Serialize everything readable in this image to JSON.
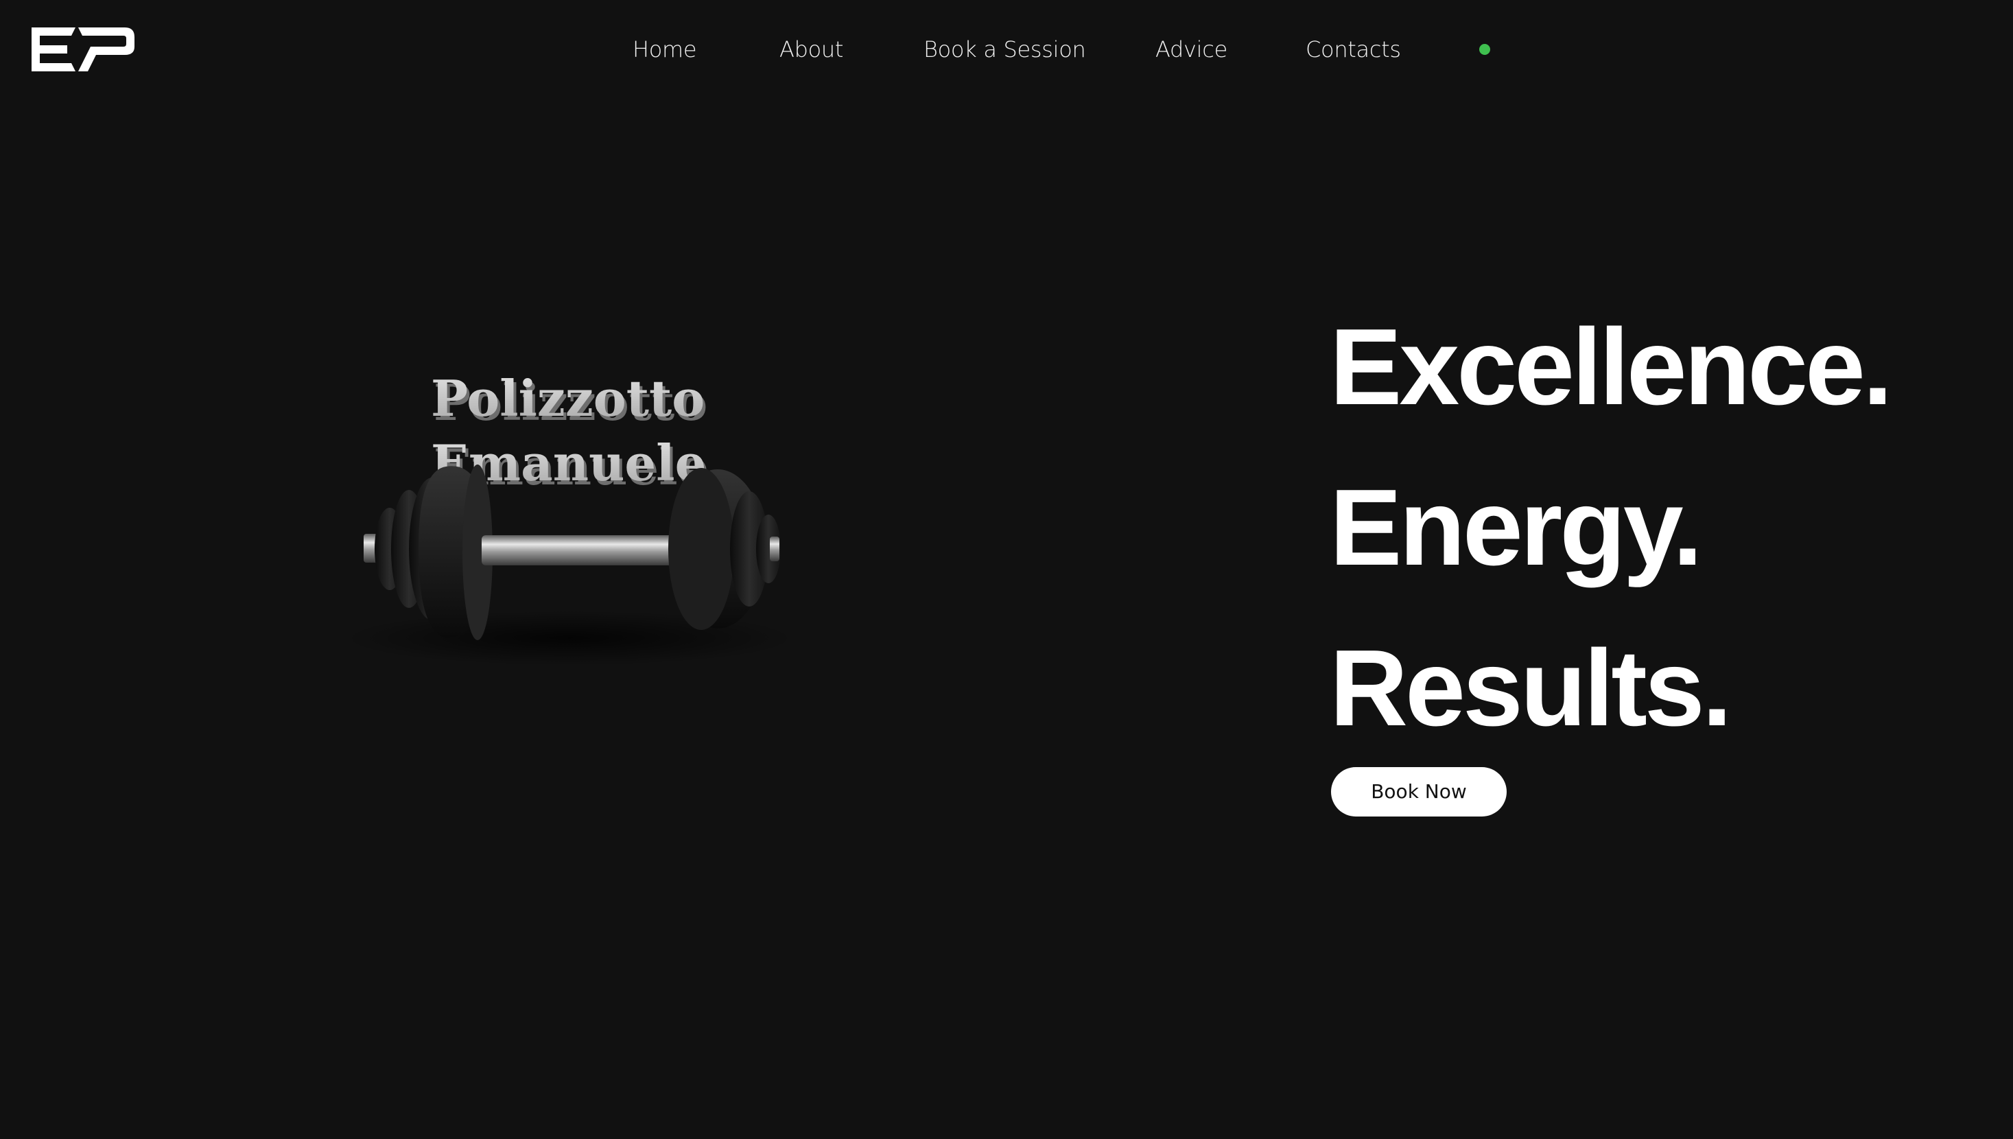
{
  "brand": {
    "logo_icon": "ep-logo-icon"
  },
  "nav": {
    "items": [
      {
        "label": "Home"
      },
      {
        "label": "About"
      },
      {
        "label": "Book a Session"
      },
      {
        "label": "Advice"
      },
      {
        "label": "Contacts"
      }
    ],
    "status_color": "#3fbf4f"
  },
  "hero": {
    "graphic": {
      "icon": "dumbbell-icon",
      "name_line1": "Polizzotto",
      "name_line2": "Emanuele"
    },
    "headline": [
      "Excellence.",
      "Energy.",
      "Results."
    ],
    "cta_label": "Book Now"
  },
  "colors": {
    "background": "#111111",
    "text": "#ffffff",
    "button_bg": "#ffffff",
    "button_text": "#111111",
    "accent": "#3fbf4f"
  }
}
